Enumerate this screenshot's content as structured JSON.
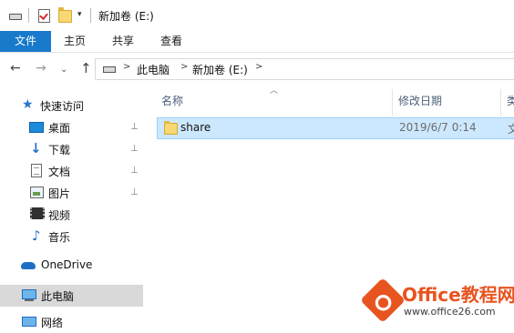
{
  "window": {
    "title": "新加卷 (E:)"
  },
  "qat": {
    "dropdown_glyph": "▾"
  },
  "ribbon": {
    "tabs": [
      "文件",
      "主页",
      "共享",
      "查看"
    ]
  },
  "address": {
    "back": "←",
    "forward": "→",
    "recent": "⌄",
    "up": "↑",
    "crumbs": [
      "此电脑",
      "新加卷 (E:)"
    ],
    "separator": ">"
  },
  "nav_pane": {
    "quick_access": "快速访问",
    "items": [
      "桌面",
      "下载",
      "文档",
      "图片",
      "视频",
      "音乐"
    ],
    "onedrive": "OneDrive",
    "this_pc": "此电脑",
    "network": "网络",
    "pin_glyph": "⊥"
  },
  "columns": {
    "name": "名称",
    "modified": "修改日期",
    "type": "类"
  },
  "files": [
    {
      "name": "share",
      "modified": "2019/6/7 0:14",
      "type": "文"
    }
  ],
  "watermark": {
    "title": "Office教程网",
    "url": "www.office26.com"
  },
  "colors": {
    "accent": "#1979ca",
    "selection": "#cce8ff",
    "selection_border": "#99d1ff",
    "folder": "#f8d775",
    "watermark": "#e8541f"
  },
  "icons": [
    "drive-icon",
    "properties-icon",
    "new-folder-icon",
    "star-icon",
    "desktop-icon",
    "download-icon",
    "document-icon",
    "picture-icon",
    "video-icon",
    "music-icon",
    "onedrive-icon",
    "computer-icon",
    "network-icon",
    "folder-icon"
  ]
}
